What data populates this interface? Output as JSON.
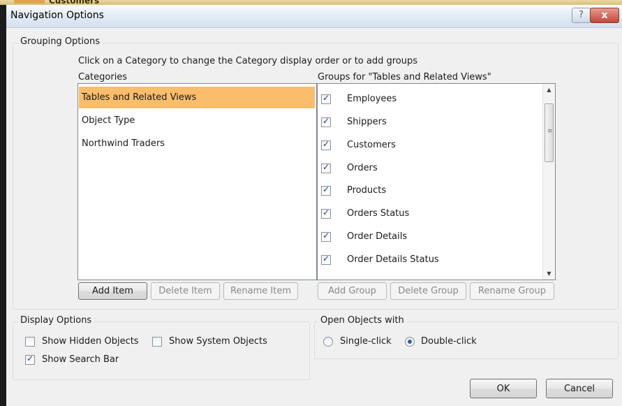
{
  "background_snippet": "Customers",
  "dialog": {
    "title": "Navigation Options",
    "help_glyph": "?",
    "close_glyph": "x"
  },
  "grouping": {
    "legend": "Grouping Options",
    "instruction": "Click on a Category to change the Category display order or to add groups",
    "categories_label": "Categories",
    "groups_label": "Groups for \"Tables and Related Views\"",
    "categories": [
      {
        "label": "Tables and Related Views",
        "selected": true
      },
      {
        "label": "Object Type",
        "selected": false
      },
      {
        "label": "Northwind Traders",
        "selected": false
      }
    ],
    "groups": [
      {
        "label": "Employees",
        "checked": true
      },
      {
        "label": "Shippers",
        "checked": true
      },
      {
        "label": "Customers",
        "checked": true
      },
      {
        "label": "Orders",
        "checked": true
      },
      {
        "label": "Products",
        "checked": true
      },
      {
        "label": "Orders Status",
        "checked": true
      },
      {
        "label": "Order Details",
        "checked": true
      },
      {
        "label": "Order Details Status",
        "checked": true
      }
    ],
    "buttons": {
      "add_item": "Add Item",
      "delete_item": "Delete Item",
      "rename_item": "Rename Item",
      "add_group": "Add Group",
      "delete_group": "Delete Group",
      "rename_group": "Rename Group"
    }
  },
  "display_options": {
    "legend": "Display Options",
    "show_hidden": {
      "label": "Show Hidden Objects",
      "checked": false
    },
    "show_system": {
      "label": "Show System Objects",
      "checked": false
    },
    "show_search": {
      "label": "Show Search Bar",
      "checked": true
    }
  },
  "open_objects": {
    "legend": "Open Objects with",
    "single_click": {
      "label": "Single-click",
      "selected": false
    },
    "double_click": {
      "label": "Double-click",
      "selected": true
    }
  },
  "footer": {
    "ok": "OK",
    "cancel": "Cancel"
  },
  "colors": {
    "selection": "#f9bd6c",
    "dialog_bg": "#f0f0f0",
    "close_button": "#c14a3a"
  }
}
